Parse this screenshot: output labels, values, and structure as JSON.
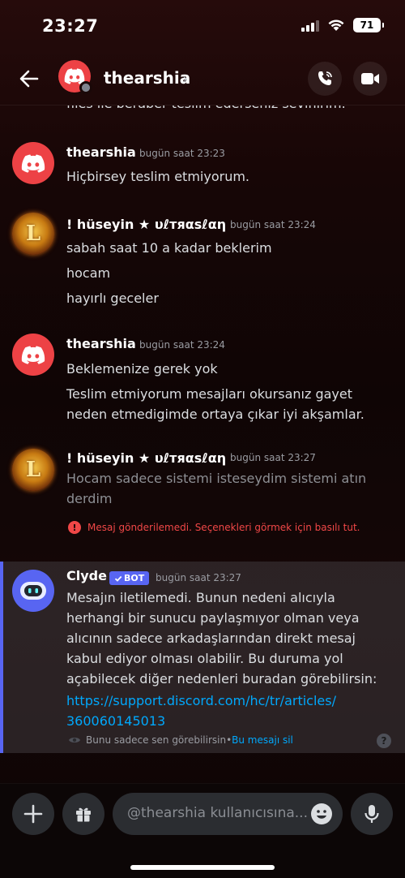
{
  "status_bar": {
    "time": "23:27",
    "battery": "71"
  },
  "header": {
    "title": "thearshia",
    "chevron": "›"
  },
  "partial_line": "files ile beraber teslim ederseniz sevinirim.",
  "messages": [
    {
      "author": "thearshia",
      "time": "bugün saat 23:23",
      "lines": [
        "Hiçbirsey teslim etmiyorum."
      ]
    },
    {
      "author": "! hüseyin ★ υℓтяαѕℓαη",
      "time": "bugün saat 23:24",
      "lines": [
        "sabah saat 10 a kadar beklerim",
        "hocam",
        "hayırlı geceler"
      ]
    },
    {
      "author": "thearshia",
      "time": "bugün saat 23:24",
      "lines": [
        "Beklemenize gerek yok",
        "Teslim etmiyorum mesajları okursanız gayet",
        "neden etmedigimde ortaya çıkar iyi akşamlar."
      ]
    },
    {
      "author": "! hüseyin ★ υℓтяαѕℓαη",
      "time": "bugün saat 23:27",
      "lines": [
        "Hocam sadece sistemi isteseydim sistemi atın",
        "derdim"
      ]
    }
  ],
  "error": {
    "icon": "!",
    "text": "Mesaj gönderilemedi. Seçenekleri görmek için basılı tut."
  },
  "clyde": {
    "author": "Clyde",
    "badge": "BOT",
    "time": "bugün saat 23:27",
    "lines": [
      "Mesajın iletilemedi. Bunun nedeni alıcıyla",
      "herhangi bir sunucu paylaşmıyor olman veya",
      "alıcının sadece arkadaşlarından direkt mesaj",
      "kabul ediyor olması olabilir. Bu duruma yol",
      "açabilecek diğer nedenleri buradan görebilirsin:"
    ],
    "link_lines": [
      "https://support.discord.com/hc/tr/articles/",
      "360060145013"
    ],
    "ephemeral_text": "Bunu sadece sen görebilirsin",
    "ephemeral_sep": " • ",
    "dismiss": "Bu mesajı sil",
    "help": "?"
  },
  "composer": {
    "placeholder": "@thearshia kullanıcısına..."
  },
  "colors": {
    "accent": "#5865f2",
    "error": "#f04747",
    "link": "#00a8fc",
    "discord_red": "#ed4245"
  },
  "icons": [
    "back-arrow-icon",
    "discord-logo-icon",
    "phone-call-icon",
    "video-camera-icon",
    "plus-icon",
    "gift-icon",
    "emoji-icon",
    "microphone-icon",
    "eye-icon",
    "checkmark-icon"
  ]
}
